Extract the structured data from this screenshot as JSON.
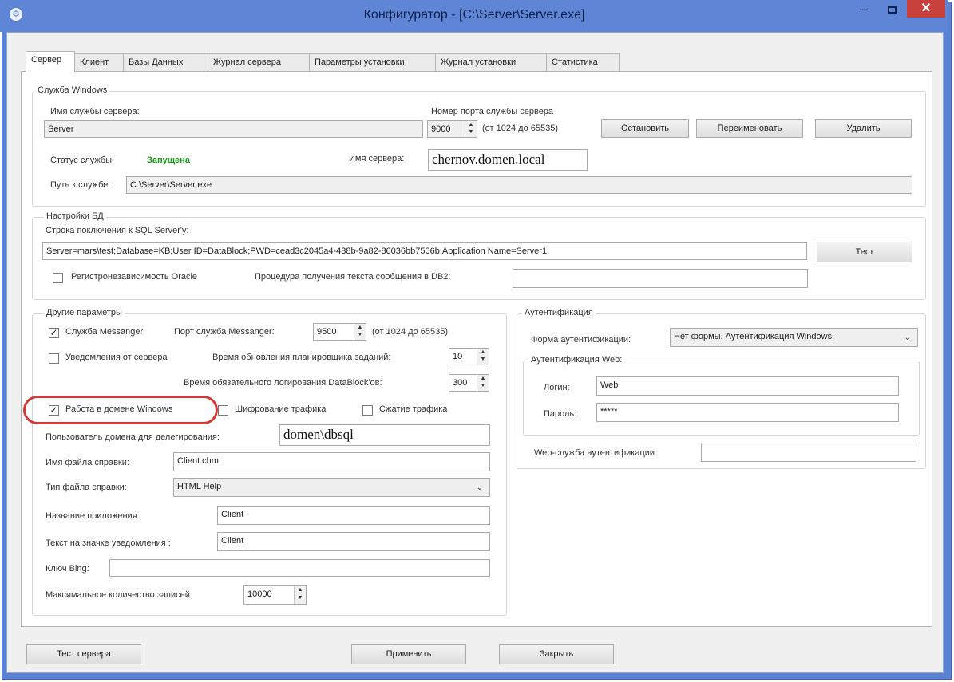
{
  "window": {
    "title": "Конфигуратор - [C:\\Server\\Server.exe]",
    "app_icon": "gear-icon",
    "minimize": "–",
    "close": "✕"
  },
  "tabs": [
    "Сервер",
    "Клиент",
    "Базы Данных",
    "Журнал сервера",
    "Параметры установки",
    "Журнал установки",
    "Статистика"
  ],
  "windows_service": {
    "group_title": "Служба Windows",
    "service_name_label": "Имя службы сервера:",
    "service_name_value": "Server",
    "port_label": "Номер порта службы сервера",
    "port_value": "9000",
    "port_range": "(от 1024 до 65535)",
    "stop_button": "Остановить",
    "rename_button": "Переименовать",
    "delete_button": "Удалить",
    "status_label": "Статус службы:",
    "status_value": "Запущена",
    "server_name_label": "Имя сервера:",
    "server_name_value": "chernov.domen.local",
    "path_label": "Путь к службе:",
    "path_value": "C:\\Server\\Server.exe"
  },
  "db_settings": {
    "group_title": "Настройки БД",
    "connection_label": "Строка поключения к SQL Server'y:",
    "connection_value": "Server=mars\\test;Database=KB;User ID=DataBlock;PWD=cead3c2045a4-438b-9a82-86036bb7506b;Application Name=Server1",
    "test_button": "Тест",
    "oracle_case_label": "Регистронезависимость Oracle",
    "oracle_case_checked": false,
    "db2_proc_label": "Процедура получения текста сообщения в DB2:",
    "db2_proc_value": ""
  },
  "other_params": {
    "group_title": "Другие параметры",
    "messenger_label": "Служба Messanger",
    "messenger_checked": true,
    "messenger_port_label": "Порт служба Messanger:",
    "messenger_port_value": "9500",
    "messenger_port_range": "(от 1024 до 65535)",
    "server_notify_label": "Уведомления от сервера",
    "server_notify_checked": false,
    "scheduler_refresh_label": "Время обновления планировщика заданий:",
    "scheduler_refresh_value": "10",
    "mandatory_log_label": "Время обязательного логирования DataBlock'ов:",
    "mandatory_log_value": "300",
    "windows_domain_label": "Работа в домене Windows",
    "windows_domain_checked": true,
    "traffic_encrypt_label": "Шифрование трафика",
    "traffic_encrypt_checked": false,
    "traffic_compress_label": "Сжатие трафика",
    "traffic_compress_checked": false,
    "delegation_user_label": "Пользователь домена для делегирования:",
    "delegation_user_value": "domen\\dbsql",
    "help_file_label": "Имя файла справки:",
    "help_file_value": "Client.chm",
    "help_type_label": "Тип файла справки:",
    "help_type_value": "HTML Help",
    "app_name_label": "Название приложения:",
    "app_name_value": "Client",
    "notify_icon_text_label": "Текст на значке уведомления :",
    "notify_icon_text_value": "Client",
    "bing_key_label": "Ключ Bing:",
    "bing_key_value": "",
    "max_records_label": "Максимальное количество записей:",
    "max_records_value": "10000"
  },
  "auth": {
    "group_title": "Аутентификация",
    "form_label": "Форма аутентификации:",
    "form_value": "Нет формы. Аутентификация Windows.",
    "web_group_title": "Аутентификация Web:",
    "login_label": "Логин:",
    "login_value": "Web",
    "password_label": "Пароль:",
    "password_value": "*****",
    "web_service_label": "Web-служба аутентификации:",
    "web_service_value": ""
  },
  "footer": {
    "test_server_button": "Тест сервера",
    "apply_button": "Применить",
    "close_button": "Закрыть"
  },
  "colors": {
    "titlebar": "#5f86d6",
    "close": "#c7423c",
    "status_ok": "#1d9a1d",
    "highlight": "#d33a33"
  }
}
